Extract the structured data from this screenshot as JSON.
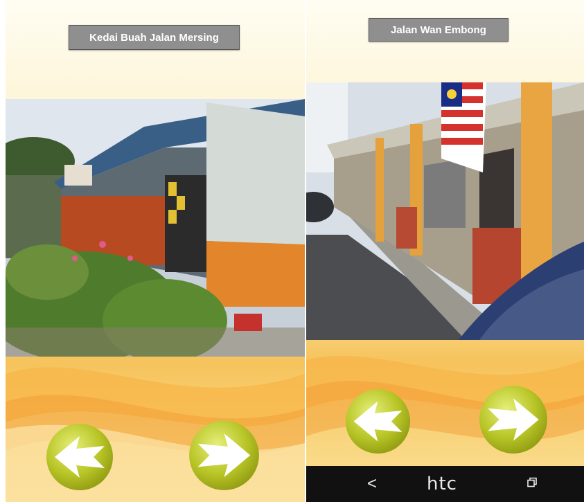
{
  "left_screen": {
    "title": "Kedai Buah Jalan Mersing",
    "photo_subject": "roadside fruit stall with corrugated roof and shrubs",
    "back_icon": "arrow-left-icon",
    "next_icon": "arrow-right-icon"
  },
  "right_screen": {
    "title": "Jalan Wan Embong",
    "photo_subject": "row of shophouses with Malaysian flag and parked car",
    "back_icon": "arrow-left-icon",
    "next_icon": "arrow-right-icon"
  },
  "system_bar": {
    "back_glyph": "<",
    "brand": "htc",
    "recents_icon": "recent-apps-icon"
  },
  "colors": {
    "title_bg": "#8f8f8f",
    "button_green": "#b9c72a",
    "bg_yellow": "#fbe7a1",
    "bg_orange": "#f2a43c"
  }
}
